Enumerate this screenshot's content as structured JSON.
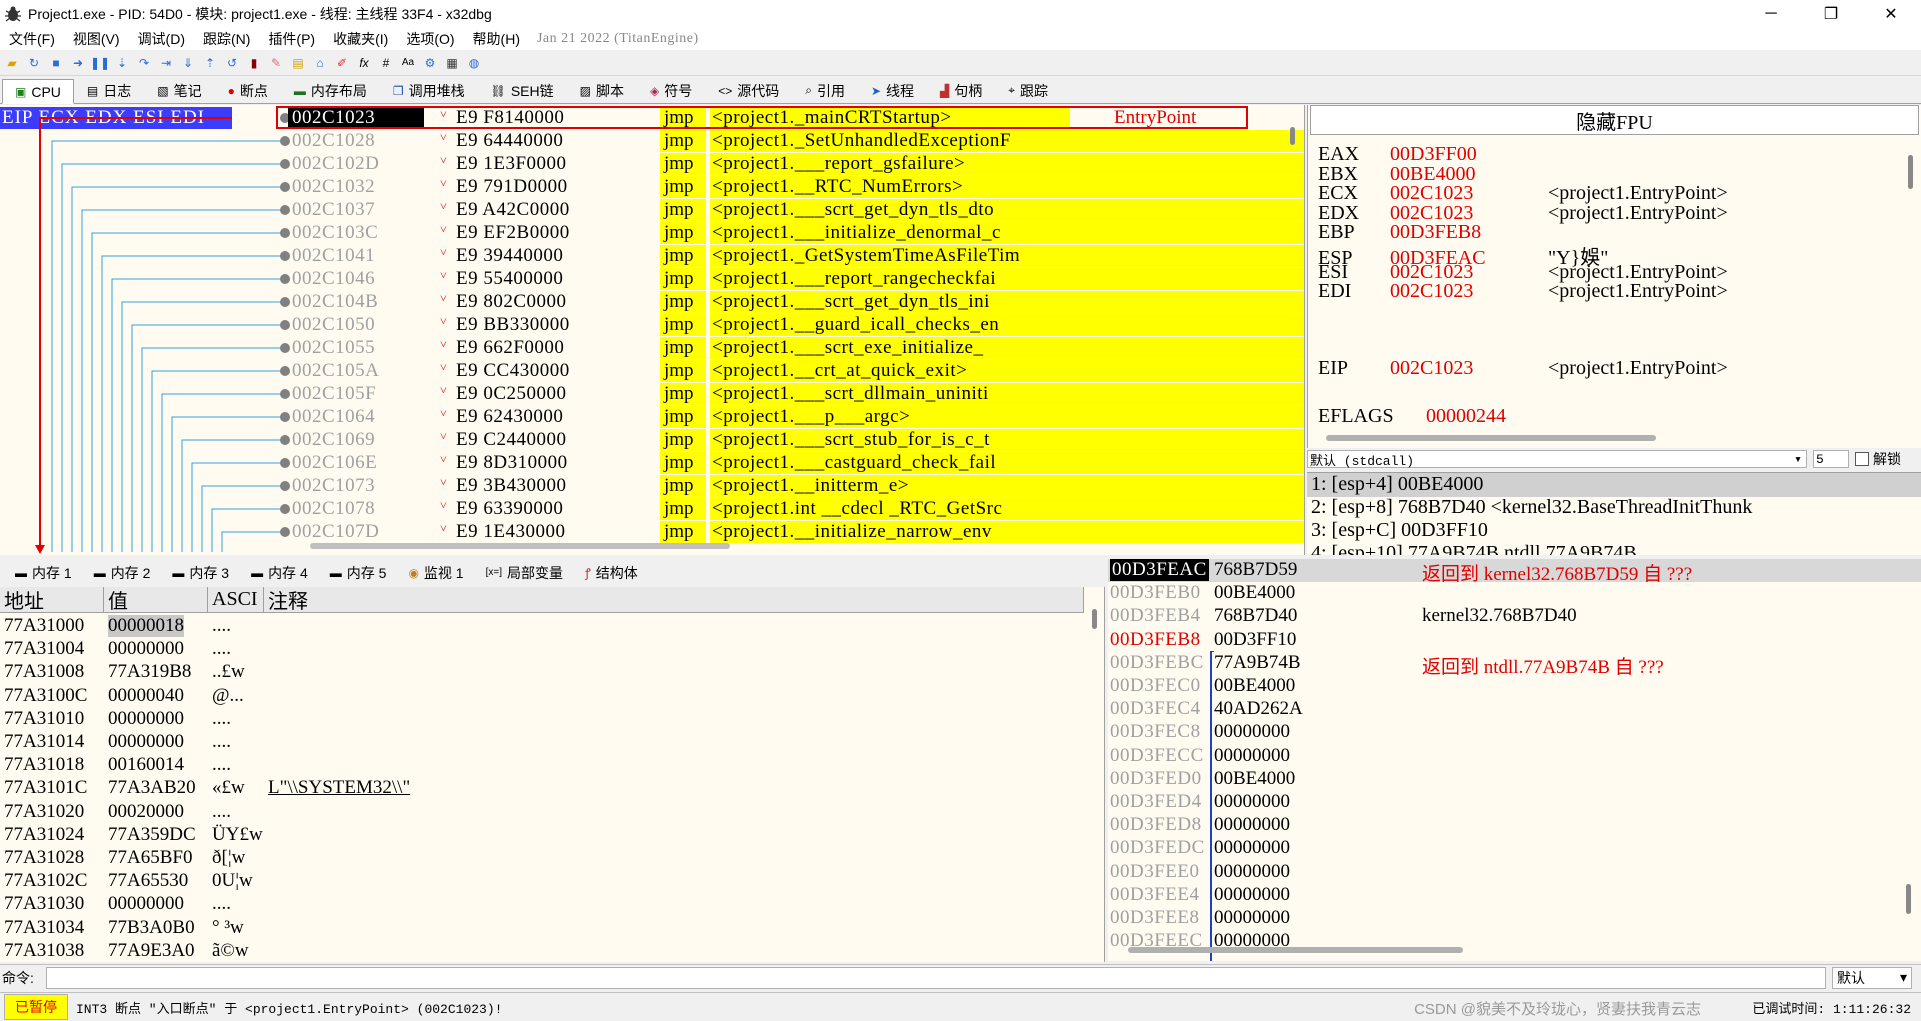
{
  "window": {
    "title": "Project1.exe - PID: 54D0 - 模块: project1.exe - 线程: 主线程 33F4 - x32dbg",
    "minimize": "─",
    "maximize": "❐",
    "close": "✕"
  },
  "menu": {
    "items": [
      "文件(F)",
      "视图(V)",
      "调试(D)",
      "跟踪(N)",
      "插件(P)",
      "收藏夹(I)",
      "选项(O)",
      "帮助(H)"
    ],
    "build": "Jan 21 2022 (TitanEngine)"
  },
  "toolbar": {
    "icons": [
      "open-icon",
      "restart-icon",
      "stop-icon",
      "run-icon",
      "pause-icon",
      "step-into-icon",
      "step-over-icon",
      "trace-into-icon",
      "trace-over-icon",
      "run-to-user-icon",
      "execute-till-return-icon",
      "highlight-icon",
      "patch-icon",
      "comment-icon",
      "label-icon",
      "bookmark-icon",
      "function-icon",
      "fx-icon",
      "hash-icon",
      "font-icon",
      "settings-icon",
      "calculator-icon",
      "globe-icon"
    ]
  },
  "main_tabs": [
    {
      "label": "CPU",
      "icon": "cpu-icon"
    },
    {
      "label": "日志",
      "icon": "log-icon"
    },
    {
      "label": "笔记",
      "icon": "notes-icon"
    },
    {
      "label": "断点",
      "icon": "breakpoint-icon"
    },
    {
      "label": "内存布局",
      "icon": "memory-map-icon"
    },
    {
      "label": "调用堆栈",
      "icon": "call-stack-icon"
    },
    {
      "label": "SEH链",
      "icon": "seh-icon"
    },
    {
      "label": "脚本",
      "icon": "script-icon"
    },
    {
      "label": "符号",
      "icon": "symbols-icon"
    },
    {
      "label": "源代码",
      "icon": "source-icon"
    },
    {
      "label": "引用",
      "icon": "references-icon"
    },
    {
      "label": "线程",
      "icon": "threads-icon"
    },
    {
      "label": "句柄",
      "icon": "handles-icon"
    },
    {
      "label": "跟踪",
      "icon": "trace-icon"
    }
  ],
  "disasm": {
    "register_badge": "EIP ECX EDX ESI EDI",
    "rows": [
      {
        "addr": "002C1023",
        "bytes": "E9 F8140000",
        "instr": "jmp",
        "operand": "<project1._mainCRTStartup>",
        "comment": "EntryPoint"
      },
      {
        "addr": "002C1028",
        "bytes": "E9 64440000",
        "instr": "jmp",
        "operand": "<project1._SetUnhandledExceptionF",
        "comment": ""
      },
      {
        "addr": "002C102D",
        "bytes": "E9 1E3F0000",
        "instr": "jmp",
        "operand": "<project1.___report_gsfailure>",
        "comment": ""
      },
      {
        "addr": "002C1032",
        "bytes": "E9 791D0000",
        "instr": "jmp",
        "operand": "<project1.__RTC_NumErrors>",
        "comment": ""
      },
      {
        "addr": "002C1037",
        "bytes": "E9 A42C0000",
        "instr": "jmp",
        "operand": "<project1.___scrt_get_dyn_tls_dto",
        "comment": ""
      },
      {
        "addr": "002C103C",
        "bytes": "E9 EF2B0000",
        "instr": "jmp",
        "operand": "<project1.___initialize_denormal_c",
        "comment": ""
      },
      {
        "addr": "002C1041",
        "bytes": "E9 39440000",
        "instr": "jmp",
        "operand": "<project1._GetSystemTimeAsFileTim",
        "comment": ""
      },
      {
        "addr": "002C1046",
        "bytes": "E9 55400000",
        "instr": "jmp",
        "operand": "<project1.___report_rangecheckfai",
        "comment": ""
      },
      {
        "addr": "002C104B",
        "bytes": "E9 802C0000",
        "instr": "jmp",
        "operand": "<project1.___scrt_get_dyn_tls_ini",
        "comment": ""
      },
      {
        "addr": "002C1050",
        "bytes": "E9 BB330000",
        "instr": "jmp",
        "operand": "<project1.__guard_icall_checks_en",
        "comment": ""
      },
      {
        "addr": "002C1055",
        "bytes": "E9 662F0000",
        "instr": "jmp",
        "operand": "<project1.___scrt_exe_initialize_",
        "comment": ""
      },
      {
        "addr": "002C105A",
        "bytes": "E9 CC430000",
        "instr": "jmp",
        "operand": "<project1.__crt_at_quick_exit>",
        "comment": ""
      },
      {
        "addr": "002C105F",
        "bytes": "E9 0C250000",
        "instr": "jmp",
        "operand": "<project1.___scrt_dllmain_uniniti",
        "comment": ""
      },
      {
        "addr": "002C1064",
        "bytes": "E9 62430000",
        "instr": "jmp",
        "operand": "<project1.___p___argc>",
        "comment": ""
      },
      {
        "addr": "002C1069",
        "bytes": "E9 C2440000",
        "instr": "jmp",
        "operand": "<project1.___scrt_stub_for_is_c_t",
        "comment": ""
      },
      {
        "addr": "002C106E",
        "bytes": "E9 8D310000",
        "instr": "jmp",
        "operand": "<project1.___castguard_check_fail",
        "comment": ""
      },
      {
        "addr": "002C1073",
        "bytes": "E9 3B430000",
        "instr": "jmp",
        "operand": "<project1.__initterm_e>",
        "comment": ""
      },
      {
        "addr": "002C1078",
        "bytes": "E9 63390000",
        "instr": "jmp",
        "operand": "<project1.int __cdecl _RTC_GetSrc",
        "comment": ""
      },
      {
        "addr": "002C107D",
        "bytes": "E9 1E430000",
        "instr": "jmp",
        "operand": "<project1.__initialize_narrow_env",
        "comment": ""
      }
    ]
  },
  "registers": {
    "header": "隐藏FPU",
    "rows": [
      {
        "name": "EAX",
        "value": "00D3FF00",
        "comment": ""
      },
      {
        "name": "EBX",
        "value": "00BE4000",
        "comment": ""
      },
      {
        "name": "ECX",
        "value": "002C1023",
        "comment": "<project1.EntryPoint>"
      },
      {
        "name": "EDX",
        "value": "002C1023",
        "comment": "<project1.EntryPoint>"
      },
      {
        "name": "EBP",
        "value": "00D3FEB8",
        "comment": ""
      },
      {
        "name": "ESP",
        "value": "00D3FEAC",
        "comment": "\"Y}娛\""
      },
      {
        "name": "ESI",
        "value": "002C1023",
        "comment": "<project1.EntryPoint>"
      },
      {
        "name": "EDI",
        "value": "002C1023",
        "comment": "<project1.EntryPoint>"
      }
    ],
    "eip": {
      "name": "EIP",
      "value": "002C1023",
      "comment": "<project1.EntryPoint>"
    },
    "eflags": {
      "name": "EFLAGS",
      "value": "00000244"
    }
  },
  "callconv": {
    "selected": "默认 (stdcall)",
    "count": "5",
    "unlock_label": "解锁"
  },
  "args": [
    "1: [esp+4] 00BE4000",
    "2: [esp+8] 768B7D40 <kernel32.BaseThreadInitThunk",
    "3: [esp+C] 00D3FF10",
    "4: [esp+10] 77A9B74B ntdll.77A9B74B"
  ],
  "lower_tabs": [
    {
      "label": "内存 1",
      "icon": "memory-icon"
    },
    {
      "label": "内存 2",
      "icon": "memory-icon"
    },
    {
      "label": "内存 3",
      "icon": "memory-icon"
    },
    {
      "label": "内存 4",
      "icon": "memory-icon"
    },
    {
      "label": "内存 5",
      "icon": "memory-icon"
    },
    {
      "label": "监视 1",
      "icon": "watch-icon"
    },
    {
      "label": "局部变量",
      "icon": "locals-icon"
    },
    {
      "label": "结构体",
      "icon": "struct-icon"
    }
  ],
  "dump": {
    "headers": [
      "地址",
      "值",
      "ASCI",
      "注释"
    ],
    "rows": [
      {
        "addr": "77A31000",
        "value": "00000018",
        "ascii": "....",
        "comment": ""
      },
      {
        "addr": "77A31004",
        "value": "00000000",
        "ascii": "....",
        "comment": ""
      },
      {
        "addr": "77A31008",
        "value": "77A319B8",
        "ascii": "..£w",
        "comment": ""
      },
      {
        "addr": "77A3100C",
        "value": "00000040",
        "ascii": "@...",
        "comment": ""
      },
      {
        "addr": "77A31010",
        "value": "00000000",
        "ascii": "....",
        "comment": ""
      },
      {
        "addr": "77A31014",
        "value": "00000000",
        "ascii": "....",
        "comment": ""
      },
      {
        "addr": "77A31018",
        "value": "00160014",
        "ascii": "....",
        "comment": ""
      },
      {
        "addr": "77A3101C",
        "value": "77A3AB20",
        "ascii": " «£w",
        "comment": "L\"\\\\SYSTEM32\\\\\""
      },
      {
        "addr": "77A31020",
        "value": "00020000",
        "ascii": "....",
        "comment": ""
      },
      {
        "addr": "77A31024",
        "value": "77A359DC",
        "ascii": "ÜY£w",
        "comment": ""
      },
      {
        "addr": "77A31028",
        "value": "77A65BF0",
        "ascii": "ð[¦w",
        "comment": ""
      },
      {
        "addr": "77A3102C",
        "value": "77A65530",
        "ascii": "0U¦w",
        "comment": ""
      },
      {
        "addr": "77A31030",
        "value": "00000000",
        "ascii": "....",
        "comment": ""
      },
      {
        "addr": "77A31034",
        "value": "77B3A0B0",
        "ascii": "° ³w",
        "comment": ""
      },
      {
        "addr": "77A31038",
        "value": "77A9E3A0",
        "ascii": " ã©w",
        "comment": ""
      }
    ]
  },
  "stack": {
    "rows": [
      {
        "addr": "00D3FEAC",
        "value": "768B7D59",
        "comment": "返回到 kernel32.768B7D59 自 ???"
      },
      {
        "addr": "00D3FEB0",
        "value": "00BE4000",
        "comment": ""
      },
      {
        "addr": "00D3FEB4",
        "value": "768B7D40",
        "comment": "kernel32.768B7D40"
      },
      {
        "addr": "00D3FEB8",
        "value": "00D3FF10",
        "comment": ""
      },
      {
        "addr": "00D3FEBC",
        "value": "77A9B74B",
        "comment": "返回到 ntdll.77A9B74B 自 ???"
      },
      {
        "addr": "00D3FEC0",
        "value": "00BE4000",
        "comment": ""
      },
      {
        "addr": "00D3FEC4",
        "value": "40AD262A",
        "comment": ""
      },
      {
        "addr": "00D3FEC8",
        "value": "00000000",
        "comment": ""
      },
      {
        "addr": "00D3FECC",
        "value": "00000000",
        "comment": ""
      },
      {
        "addr": "00D3FED0",
        "value": "00BE4000",
        "comment": ""
      },
      {
        "addr": "00D3FED4",
        "value": "00000000",
        "comment": ""
      },
      {
        "addr": "00D3FED8",
        "value": "00000000",
        "comment": ""
      },
      {
        "addr": "00D3FEDC",
        "value": "00000000",
        "comment": ""
      },
      {
        "addr": "00D3FEE0",
        "value": "00000000",
        "comment": ""
      },
      {
        "addr": "00D3FEE4",
        "value": "00000000",
        "comment": ""
      },
      {
        "addr": "00D3FEE8",
        "value": "00000000",
        "comment": ""
      },
      {
        "addr": "00D3FEEC",
        "value": "00000000",
        "comment": ""
      }
    ]
  },
  "command": {
    "label": "命令:",
    "mode": "默认"
  },
  "status": {
    "state": "已暂停",
    "message": "INT3 断点 \"入口断点\" 于 <project1.EntryPoint> (002C1023)!",
    "watermark": "CSDN @貌美不及玲珑心，贤妻扶我青云志",
    "time": "已调试时间:  1:11:26:32"
  },
  "colors": {
    "accent_red": "#e00000",
    "highlight_yellow": "#ffff00",
    "badge_blue": "#3c3cff",
    "pane_bg": "#fffbf0"
  }
}
